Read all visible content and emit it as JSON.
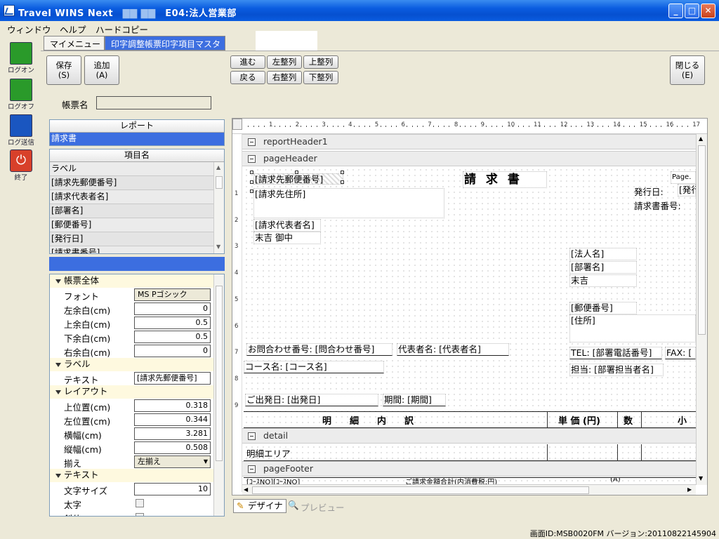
{
  "window": {
    "title_prefix": "Travel WINS Next",
    "title_suffix": "E04:法人営業部",
    "minimize": "_",
    "maximize": "□",
    "close": "✕"
  },
  "menu": [
    "ウィンドウ",
    "ヘルプ",
    "ハードコピー"
  ],
  "sidebar": [
    {
      "label": "ログオン",
      "icon": "logon-icon",
      "color": "#2a9a2a"
    },
    {
      "label": "ログオフ",
      "icon": "logoff-icon",
      "color": "#2a9a2a"
    },
    {
      "label": "ログ送信",
      "icon": "log-send-icon",
      "color": "#1a56c0"
    },
    {
      "label": "終了",
      "icon": "exit-icon",
      "color": "#d8402a"
    }
  ],
  "tabs": [
    {
      "label": "マイメニュー",
      "active": false
    },
    {
      "label": "印字調整帳票印字項目マスタ",
      "active": true
    }
  ],
  "toolbar": {
    "save": "保存",
    "save_key": "(S)",
    "add": "追加",
    "add_key": "(A)",
    "forward": "進む",
    "back": "戻る",
    "align_left": "左整列",
    "align_right": "右整列",
    "align_top": "上整列",
    "align_bottom": "下整列",
    "close": "閉じる",
    "close_key": "(E)"
  },
  "form": {
    "report_name_label": "帳票名",
    "report_name_value": ""
  },
  "report_list": {
    "header": "レポート",
    "items": [
      "請求書"
    ]
  },
  "item_list": {
    "header": "項目名",
    "items": [
      "ラベル",
      "[請求先郵便番号]",
      "[請求代表者名]",
      "[部署名]",
      "[郵便番号]",
      "[発行日]",
      "[請求書番号]"
    ]
  },
  "properties": {
    "cat_all": "帳票全体",
    "font_label": "フォント",
    "font_value": "MS Pゴシック",
    "margin_left_label": "左余白(cm)",
    "margin_left": "0",
    "margin_top_label": "上余白(cm)",
    "margin_top": "0.5",
    "margin_bottom_label": "下余白(cm)",
    "margin_bottom": "0.5",
    "margin_right_label": "右余白(cm)",
    "margin_right": "0",
    "cat_label": "ラベル",
    "text_label": "テキスト",
    "text_value": "[請求先郵便番号]",
    "cat_layout": "レイアウト",
    "top_label": "上位置(cm)",
    "top": "0.318",
    "left_label": "左位置(cm)",
    "left": "0.344",
    "width_label": "横幅(cm)",
    "width": "3.281",
    "height_label": "縦幅(cm)",
    "height": "0.508",
    "align_label": "揃え",
    "align_value": "左揃え",
    "cat_text": "テキスト",
    "fontsize_label": "文字サイズ",
    "fontsize": "10",
    "bold_label": "太字",
    "italic_label": "斜体"
  },
  "designer": {
    "ruler": [
      "1",
      "2",
      "3",
      "4",
      "5",
      "6",
      "7",
      "8",
      "9",
      "10",
      "11",
      "12",
      "13",
      "14",
      "15",
      "16",
      "17"
    ],
    "vruler": [
      "1",
      "2",
      "3",
      "4",
      "5",
      "6",
      "7",
      "8",
      "9"
    ],
    "sections": {
      "report_header": "reportHeader1",
      "page_header": "pageHeader",
      "detail": "detail",
      "page_footer": "pageFooter"
    },
    "fields": {
      "postal": "[請求先郵便番号]",
      "address": "[請求先住所]",
      "title": "請 求 書",
      "page": "Page.",
      "issue_date": "発行日:",
      "issue_val": "[発行",
      "invoice_no": "請求書番号:",
      "rep_name": "[請求代表者名]",
      "goyou": "末吉 御中",
      "corp": "[法人名]",
      "dept": "[部署名]",
      "sueyoshi": "末吉",
      "zip": "[郵便番号]",
      "addr2": "[住所]",
      "contact": "お問合わせ番号: [問合わせ番号]",
      "daihyo": "代表者名: [代表者名]",
      "tel": "TEL: [部署電話番号]",
      "fax": "FAX: [",
      "course": "コース名: [コース名]",
      "tanto": "担当: [部署担当者名]",
      "depart": "ご出発日: [出発日]",
      "period": "期間: [期間]",
      "col_detail": "明　　細　　内　　訳",
      "col_price": "単 価 (円)",
      "col_qty": "数",
      "col_sub": "小 言",
      "detail_area": "明細エリア",
      "footer1": "[ｺｰｽNO][ｺｰｽNO]",
      "footer2": "ご請求金額合計(内消費税:円)",
      "footer3": "(A)"
    }
  },
  "bottom_tabs": {
    "designer": "デザイナ",
    "preview": "プレビュー"
  },
  "status": "画面ID:MSB0020FM バージョン:20110822145904"
}
